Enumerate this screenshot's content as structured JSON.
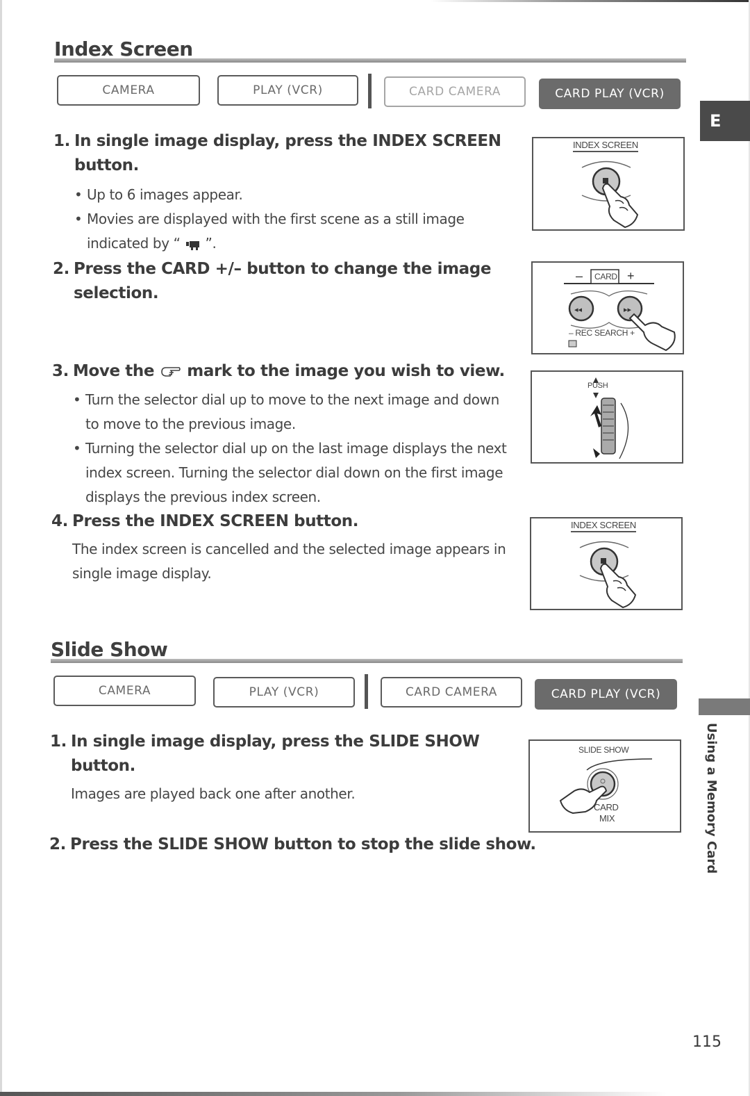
{
  "side_tab": {
    "letter": "E"
  },
  "chapter": {
    "label": "Using a Memory Card"
  },
  "page_number": "115",
  "sections": [
    {
      "title": "Index Screen",
      "modes": [
        {
          "label": "CAMERA",
          "state": "inactive"
        },
        {
          "label": "PLAY (VCR)",
          "state": "inactive"
        },
        {
          "label": "CARD CAMERA",
          "state": "disabled"
        },
        {
          "label": "CARD PLAY (VCR)",
          "state": "active"
        }
      ],
      "steps": [
        {
          "number": "1.",
          "line1": "In single image display, press the INDEX SCREEN",
          "line2": "button.",
          "bullets": [
            {
              "line1": "Up to 6 images appear."
            },
            {
              "line1": "Movies are displayed with the first scene as a still image",
              "line2_prefix": "indicated by “",
              "icon": "movie-camera-icon",
              "line2_suffix": "”."
            }
          ],
          "figure": {
            "label": "INDEX SCREEN"
          }
        },
        {
          "number": "2.",
          "line1": "Press the CARD +/– button to change the image",
          "line2": "selection.",
          "figure": {
            "top_label": "CARD",
            "minus": "–",
            "plus": "+",
            "bottom_label": "REC SEARCH"
          }
        },
        {
          "number": "3.",
          "line1_prefix": "Move the",
          "icon": "pointing-hand-icon",
          "line1_suffix": "mark to the image you wish to view.",
          "bullets": [
            {
              "line1": "Turn the selector dial up to move to the next image and down",
              "line2": "to move to the previous image."
            },
            {
              "line1": "Turning the selector dial up on the last image displays the next",
              "line2": "index screen. Turning the selector dial down on the first image",
              "line3": "displays the previous index screen."
            }
          ],
          "figure": {
            "label": "PUSH"
          }
        },
        {
          "number": "4.",
          "line1": "Press the  INDEX SCREEN button.",
          "para_line1": "The index screen is cancelled and the selected image appears in",
          "para_line2": "single image display.",
          "figure": {
            "label": "INDEX SCREEN"
          }
        }
      ]
    },
    {
      "title": "Slide Show",
      "modes": [
        {
          "label": "CAMERA",
          "state": "inactive"
        },
        {
          "label": "PLAY (VCR)",
          "state": "inactive"
        },
        {
          "label": "CARD CAMERA",
          "state": "inactive"
        },
        {
          "label": "CARD PLAY (VCR)",
          "state": "active"
        }
      ],
      "steps": [
        {
          "number": "1.",
          "line1": "In single image display, press the SLIDE SHOW",
          "line2": "button.",
          "para_line1": "Images are played back one after another.",
          "figure": {
            "label": "SLIDE SHOW",
            "sub_label_1": "CARD",
            "sub_label_2": "MIX"
          }
        },
        {
          "number": "2.",
          "line1": "Press the SLIDE SHOW button to stop the slide show."
        }
      ]
    }
  ]
}
